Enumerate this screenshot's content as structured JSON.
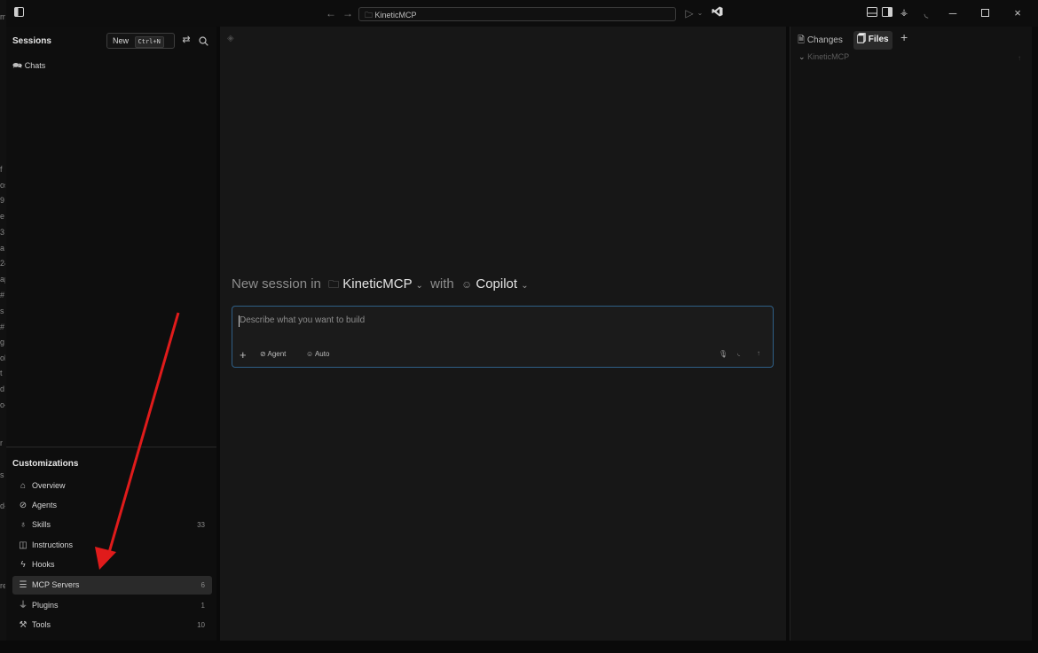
{
  "titlebar": {
    "path": "KineticMCP"
  },
  "sidebar": {
    "sessions_title": "Sessions",
    "new_label": "New",
    "new_shortcut": "Ctrl+N",
    "chats_label": "Chats",
    "customizations_title": "Customizations",
    "items": [
      {
        "label": "Overview",
        "count": "",
        "icon": "home-icon"
      },
      {
        "label": "Agents",
        "count": "",
        "icon": "agent-icon"
      },
      {
        "label": "Skills",
        "count": "33",
        "icon": "lightbulb-icon"
      },
      {
        "label": "Instructions",
        "count": "",
        "icon": "book-icon"
      },
      {
        "label": "Hooks",
        "count": "",
        "icon": "hook-icon"
      },
      {
        "label": "MCP Servers",
        "count": "6",
        "icon": "server-icon"
      },
      {
        "label": "Plugins",
        "count": "1",
        "icon": "plug-icon"
      },
      {
        "label": "Tools",
        "count": "10",
        "icon": "tools-icon"
      }
    ]
  },
  "main": {
    "heading_prefix": "New session in",
    "workspace": "KineticMCP",
    "with_label": "with",
    "provider": "Copilot",
    "placeholder": "Describe what you want to build",
    "agent_label": "Agent",
    "model_label": "Auto"
  },
  "right_panel": {
    "tab_changes": "Changes",
    "tab_files": "Files",
    "tree_root": "KineticMCP"
  },
  "gutter_fragments": [
    "m",
    "f",
    "os",
    "9",
    "e",
    "3",
    "a",
    "24",
    "ap",
    "#",
    "s",
    "#",
    "g",
    "ol",
    "t",
    "d",
    "o-",
    "r",
    "s",
    "d-",
    "re"
  ],
  "colors": {
    "accent_border": "#2f5f86",
    "annotation_arrow": "#e01b1b"
  }
}
